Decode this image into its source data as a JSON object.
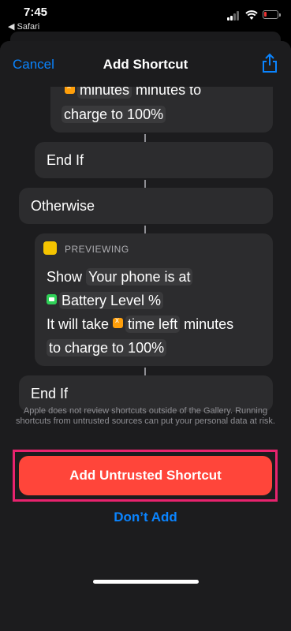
{
  "status_bar": {
    "time": "7:45",
    "back_app": "◀ Safari"
  },
  "nav": {
    "cancel": "Cancel",
    "title": "Add Shortcut"
  },
  "script": {
    "partial_block": {
      "line1_token": "minutes",
      "line1_after": "minutes to",
      "line2": "charge to 100%"
    },
    "end_if_inner": "End If",
    "otherwise": "Otherwise",
    "preview_label": "PREVIEWING",
    "show_action": {
      "verb": "Show",
      "text1": "Your phone is at",
      "battery_token": "Battery Level %",
      "text2": "It will take",
      "time_token": "time left",
      "text3": "minutes",
      "text4": "to charge to 100%"
    },
    "end_if_outer": "End If"
  },
  "disclaimer": "Apple does not review shortcuts outside of the Gallery. Running shortcuts from untrusted sources can put your personal data at risk.",
  "buttons": {
    "add": "Add Untrusted Shortcut",
    "dont_add": "Don’t Add"
  },
  "colors": {
    "accent": "#0a84ff",
    "danger": "#ff453a",
    "highlight": "#e8236e"
  }
}
